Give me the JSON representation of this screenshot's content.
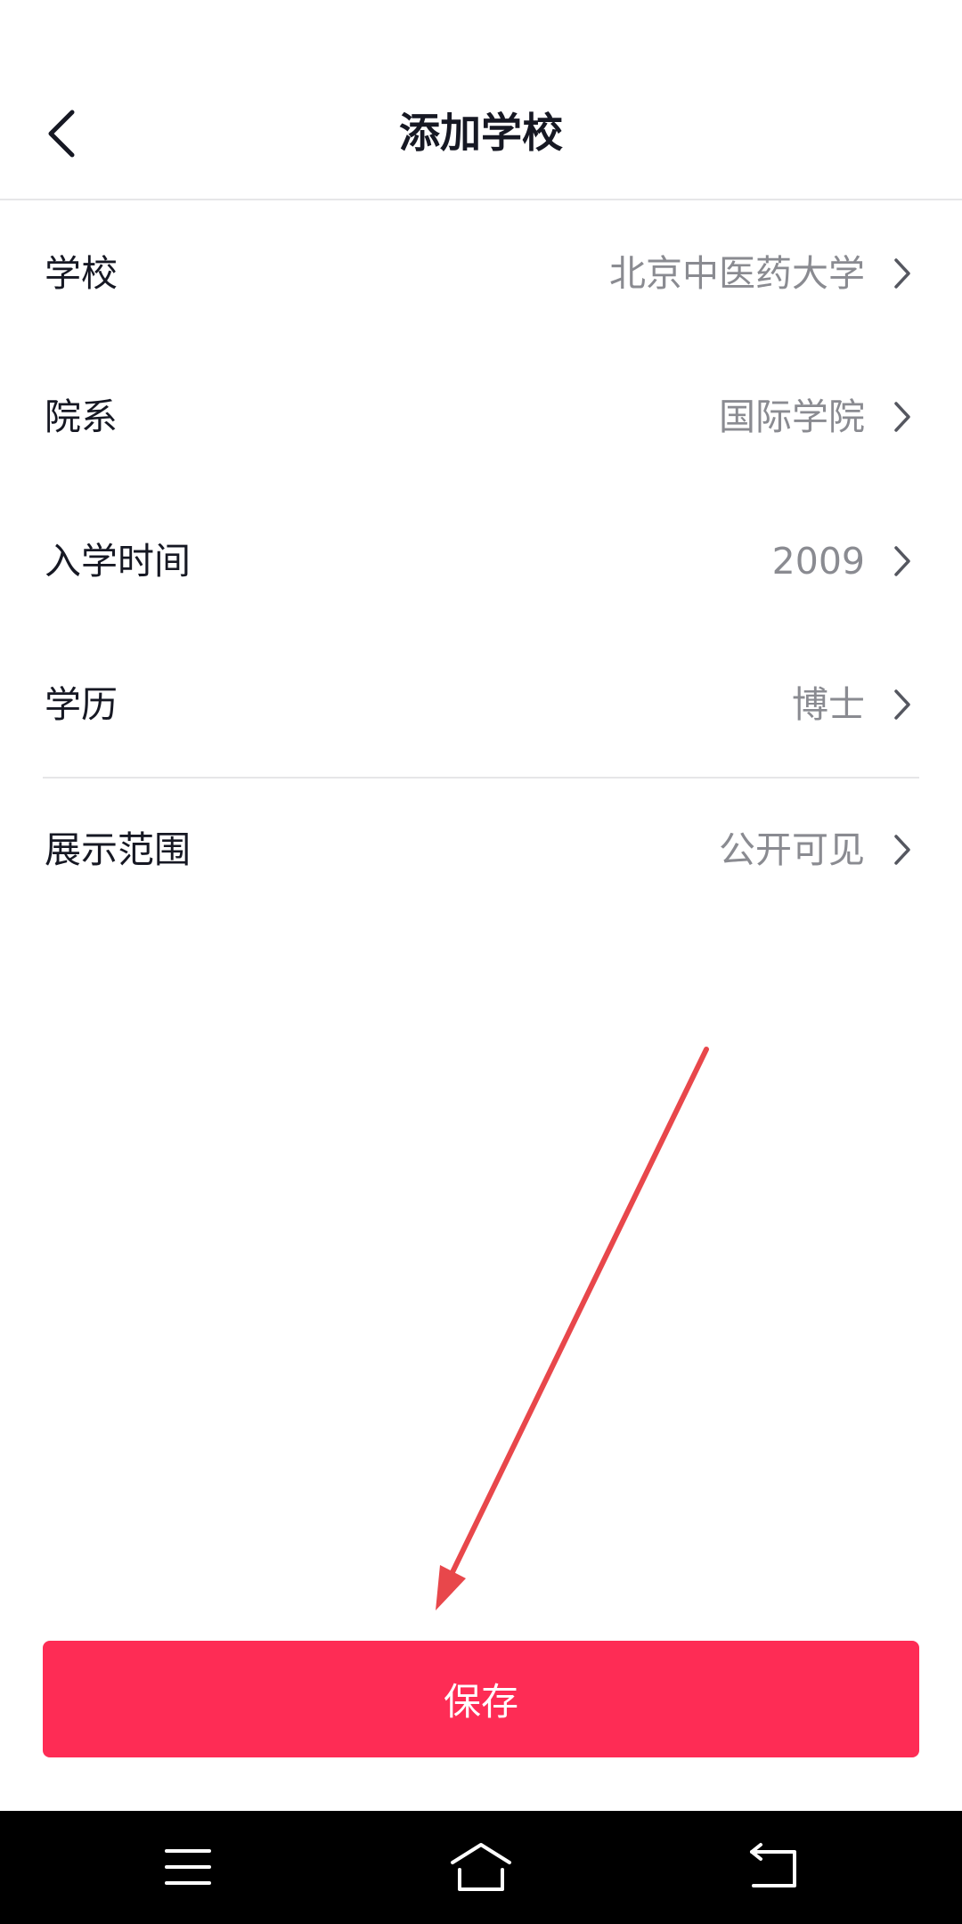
{
  "header": {
    "title": "添加学校",
    "back_icon": "chevron-left-icon"
  },
  "rows": [
    {
      "label": "学校",
      "value": "北京中医药大学",
      "icon": "chevron-right-icon"
    },
    {
      "label": "院系",
      "value": "国际学院",
      "icon": "chevron-right-icon"
    },
    {
      "label": "入学时间",
      "value": "2009",
      "icon": "chevron-right-icon"
    },
    {
      "label": "学历",
      "value": "博士",
      "icon": "chevron-right-icon"
    },
    {
      "label": "展示范围",
      "value": "公开可见",
      "icon": "chevron-right-icon"
    }
  ],
  "save_button": {
    "label": "保存"
  },
  "system_nav": {
    "icons": [
      "menu-icon",
      "home-icon",
      "back-icon"
    ]
  },
  "colors": {
    "accent": "#FE2C55",
    "label_text": "#161823",
    "value_text": "#8A8B91",
    "annotation_arrow": "#E8474B",
    "system_nav_bg": "#000000"
  }
}
